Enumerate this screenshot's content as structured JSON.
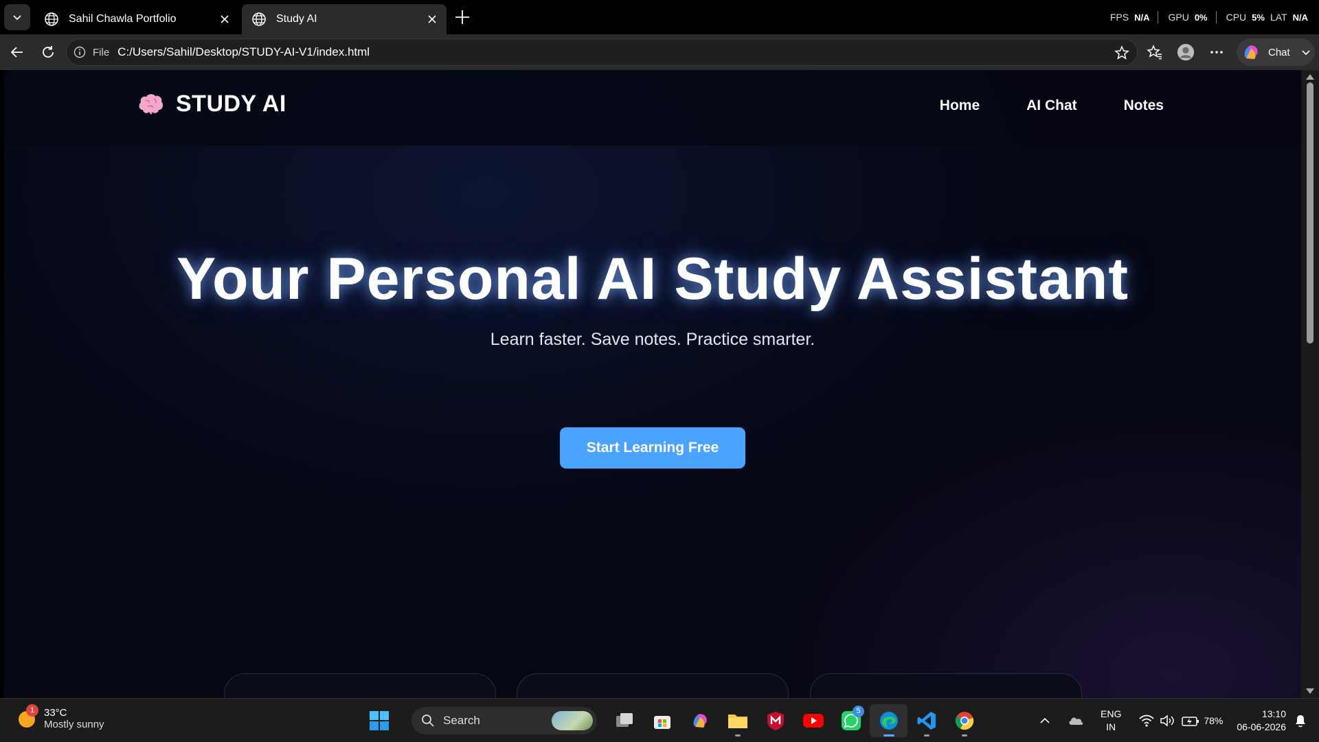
{
  "browser": {
    "tabs": [
      {
        "title": "Sahil Chawla Portfolio"
      },
      {
        "title": "Study AI"
      }
    ],
    "perf": {
      "fps_label": "FPS",
      "fps": "N/A",
      "gpu_label": "GPU",
      "gpu": "0%",
      "cpu_label": "CPU",
      "cpu": "5%",
      "lat_label": "LAT",
      "lat": "N/A"
    },
    "address": {
      "scheme_label": "File",
      "url": "C:/Users/Sahil/Desktop/STUDY-AI-V1/index.html"
    },
    "chat_label": "Chat"
  },
  "page": {
    "brand": "STUDY AI",
    "nav": [
      "Home",
      "AI Chat",
      "Notes"
    ],
    "hero_title": "Your Personal AI Study Assistant",
    "hero_subtitle": "Learn faster. Save notes. Practice smarter.",
    "cta_label": "Start Learning Free"
  },
  "taskbar": {
    "weather": {
      "temp": "33°C",
      "desc": "Mostly sunny",
      "badge": "1"
    },
    "search_label": "Search",
    "whatsapp_badge": "5",
    "language": {
      "line1": "ENG",
      "line2": "IN"
    },
    "battery": "78%",
    "clock": {
      "time": "13:10",
      "date": "06-06-2026"
    }
  },
  "colors": {
    "accent": "#4aa3ff",
    "page_bg": "#050713"
  }
}
